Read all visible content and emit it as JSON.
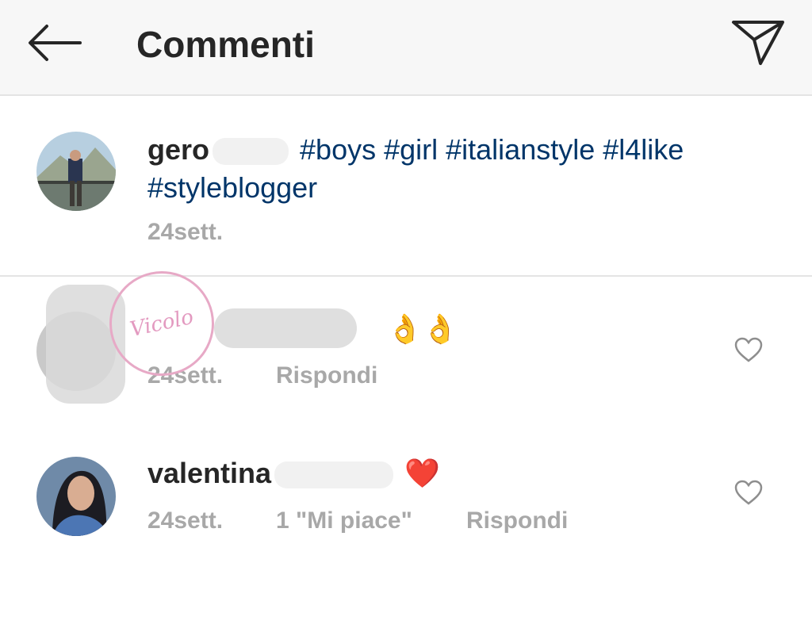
{
  "header": {
    "title": "Commenti",
    "back_icon": "arrow-left-icon",
    "send_icon": "paper-plane-icon"
  },
  "caption": {
    "username": "gero",
    "hashtags": "#boys #girl #italianstyle #l4like #styleblogger",
    "time": "24sett."
  },
  "comments": [
    {
      "username": "",
      "time": "24sett.",
      "reply_label": "Rispondi",
      "emoji": "👌👌"
    },
    {
      "username": "valentina",
      "emoji": "❤️",
      "time": "24sett.",
      "likes_label": "1 \"Mi piace\"",
      "reply_label": "Rispondi"
    }
  ],
  "colors": {
    "hashtag": "#003569",
    "meta": "#a8a8a8",
    "header_bg": "#f7f7f7"
  }
}
